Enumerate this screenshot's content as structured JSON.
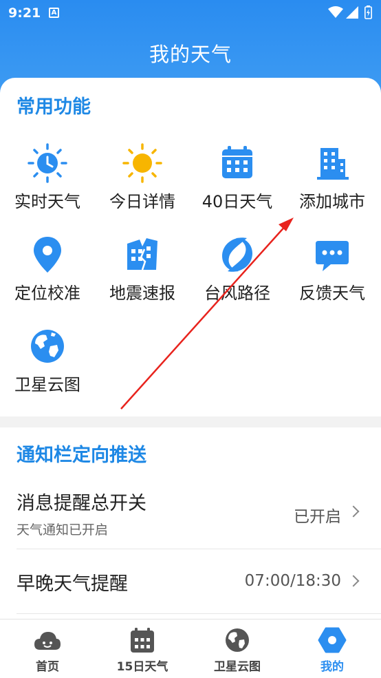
{
  "status_bar": {
    "time": "9:21",
    "notification_letter": "A"
  },
  "header": {
    "title": "我的天气"
  },
  "common_functions": {
    "title": "常用功能",
    "items": [
      {
        "label": "实时天气",
        "icon": "sun-clock-icon"
      },
      {
        "label": "今日详情",
        "icon": "sun-icon"
      },
      {
        "label": "40日天气",
        "icon": "calendar-icon"
      },
      {
        "label": "添加城市",
        "icon": "building-icon"
      },
      {
        "label": "定位校准",
        "icon": "location-pin-icon"
      },
      {
        "label": "地震速报",
        "icon": "earthquake-building-icon"
      },
      {
        "label": "台风路径",
        "icon": "typhoon-icon"
      },
      {
        "label": "反馈天气",
        "icon": "chat-bubble-icon"
      },
      {
        "label": "卫星云图",
        "icon": "globe-icon"
      }
    ]
  },
  "push_section": {
    "title": "通知栏定向推送",
    "rows": [
      {
        "label": "消息提醒总开关",
        "sub": "天气通知已开启",
        "value": "已开启"
      },
      {
        "label": "早晚天气提醒",
        "value": "07:00/18:30"
      }
    ]
  },
  "bottom_nav": {
    "items": [
      {
        "label": "首页",
        "icon": "cloud-face-icon",
        "active": false
      },
      {
        "label": "15日天气",
        "icon": "calendar-icon",
        "active": false
      },
      {
        "label": "卫星云图",
        "icon": "globe-icon",
        "active": false
      },
      {
        "label": "我的",
        "icon": "hexagon-icon",
        "active": true
      }
    ]
  },
  "colors": {
    "accent": "#2b8ef0",
    "annotation_arrow": "#e8231d"
  }
}
